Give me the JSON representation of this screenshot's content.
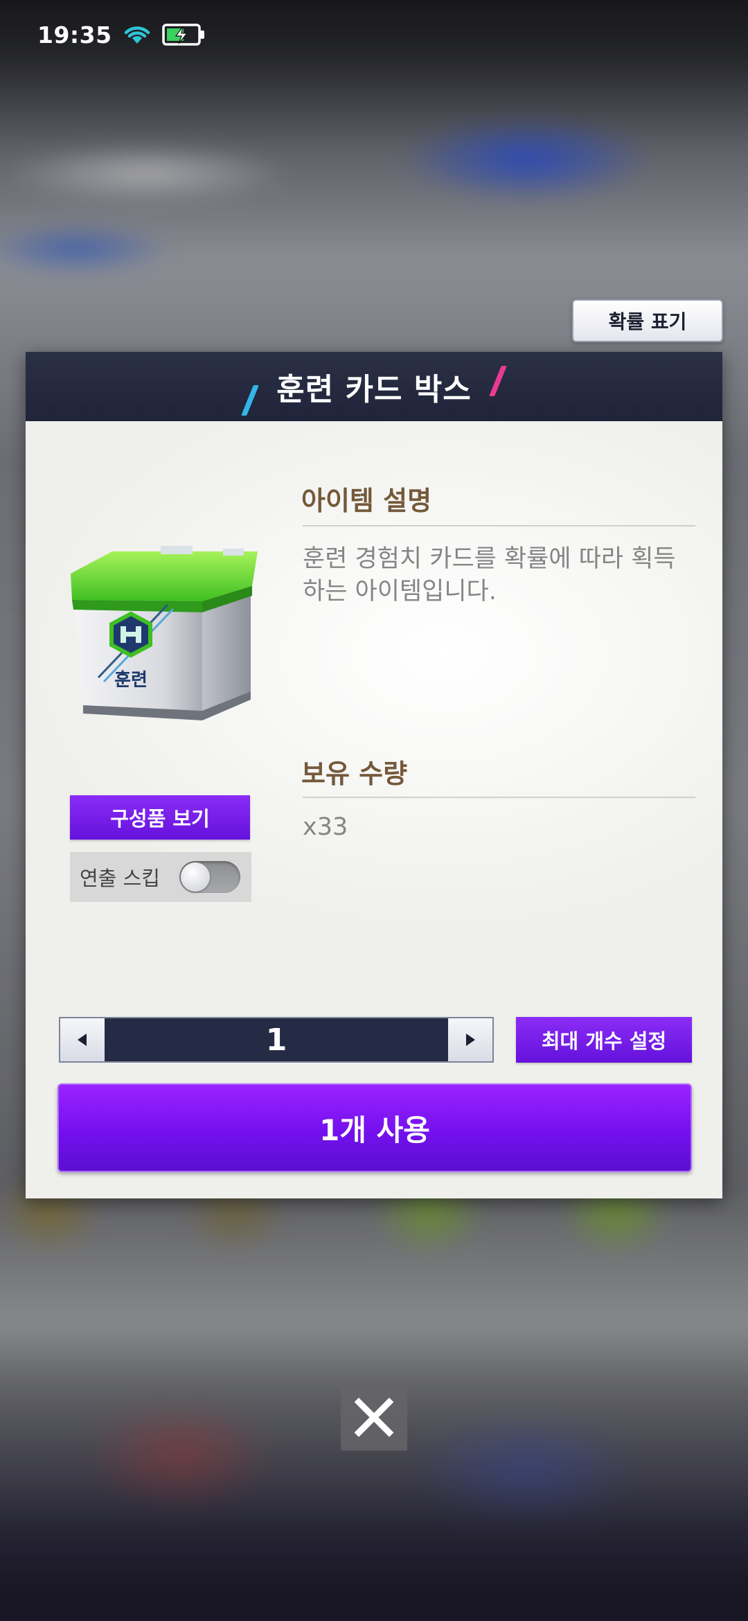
{
  "status_bar": {
    "time": "19:35",
    "icons": [
      "wifi-icon",
      "battery-charging-icon"
    ]
  },
  "probability_button": {
    "label": "확률 표기"
  },
  "modal": {
    "title": "훈련 카드 박스",
    "item": {
      "image_label": "훈련",
      "icon": "training-box-icon"
    },
    "description": {
      "title": "아이템 설명",
      "text": "훈련 경험치 카드를 확률에 따라 획득하는 아이템입니다."
    },
    "quantity": {
      "title": "보유 수량",
      "value": "x33"
    },
    "components_button": {
      "label": "구성품 보기"
    },
    "skip_animation": {
      "label": "연출 스킵",
      "enabled": false
    },
    "stepper": {
      "value": "1",
      "decrease_icon": "triangle-left-icon",
      "increase_icon": "triangle-right-icon"
    },
    "max_button": {
      "label": "최대 개수 설정"
    },
    "use_button": {
      "label": "1개 사용"
    }
  },
  "close_button": {
    "icon": "close-icon"
  },
  "colors": {
    "accent_purple": "#7410ee",
    "header_navy": "#20243a",
    "section_title_brown": "#74593a",
    "slash_blue": "#33b5e8",
    "slash_pink": "#e83a92"
  }
}
